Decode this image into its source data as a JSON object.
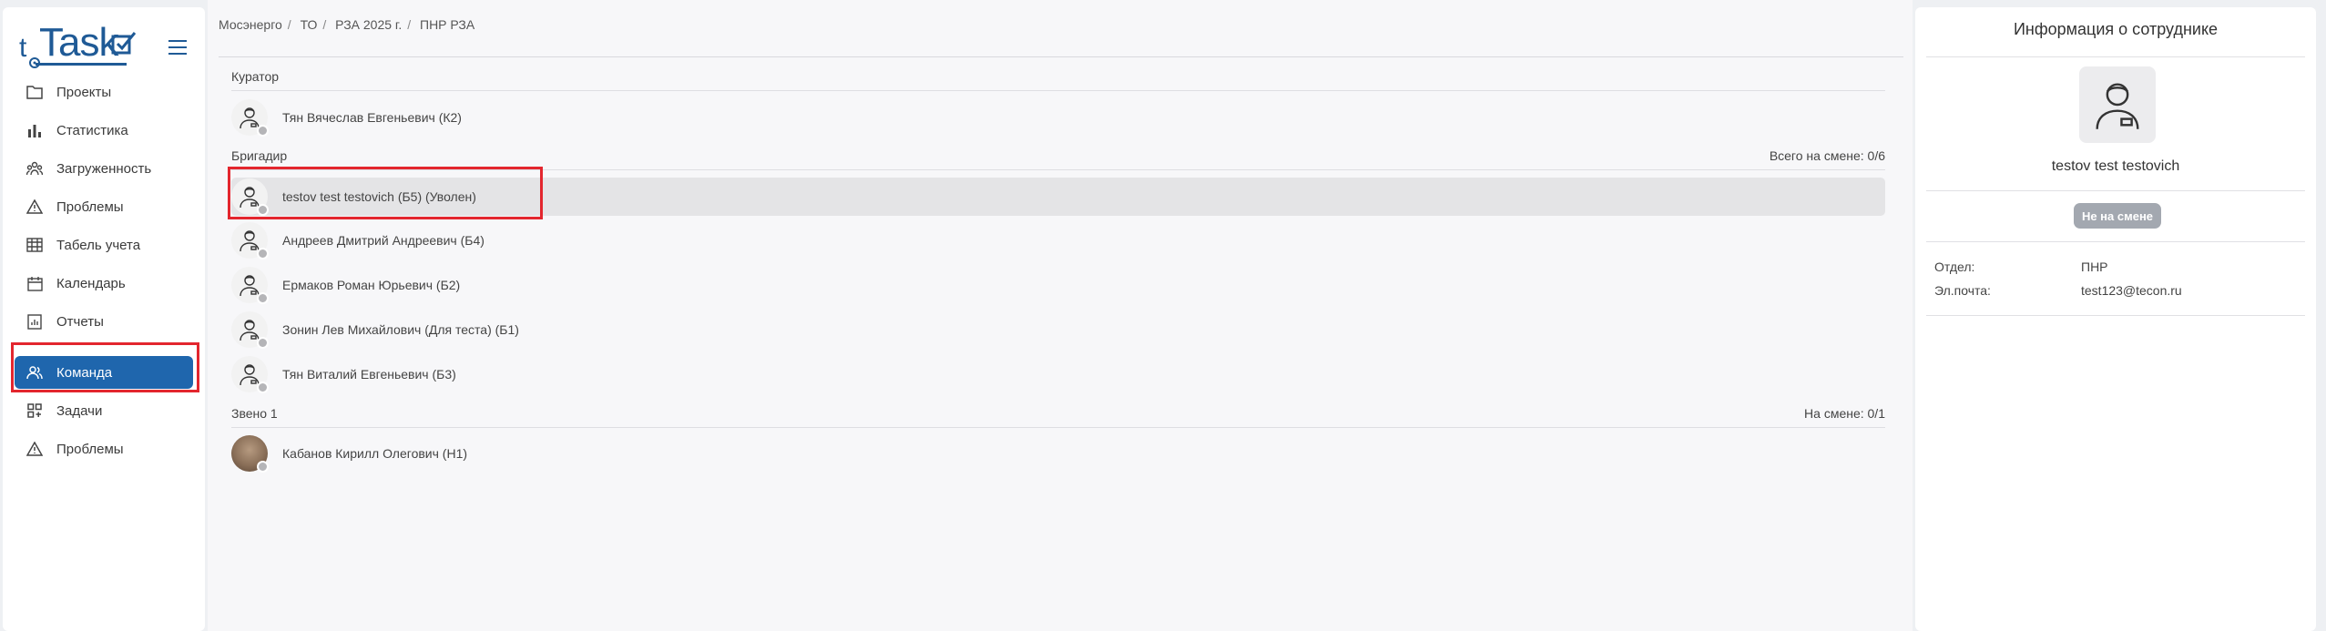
{
  "logo": {
    "small": "t",
    "text": "Task"
  },
  "sidebar": {
    "items": [
      {
        "label": "Проекты",
        "icon": "folder-icon"
      },
      {
        "label": "Статистика",
        "icon": "bar-chart-icon"
      },
      {
        "label": "Загруженность",
        "icon": "people-icon"
      },
      {
        "label": "Проблемы",
        "icon": "warning-icon"
      },
      {
        "label": "Табель учета",
        "icon": "table-icon"
      },
      {
        "label": "Календарь",
        "icon": "calendar-icon"
      },
      {
        "label": "Отчеты",
        "icon": "report-icon"
      }
    ],
    "items2": [
      {
        "label": "Команда",
        "icon": "team-icon"
      },
      {
        "label": "Задачи",
        "icon": "tasks-icon"
      },
      {
        "label": "Проблемы",
        "icon": "warning-icon"
      }
    ]
  },
  "breadcrumb": [
    "Мосэнерго",
    "ТО",
    "РЗА 2025 г.",
    "ПНР РЗА"
  ],
  "groups": {
    "curator": {
      "title": "Куратор",
      "members": [
        "Тян Вячеслав Евгеньевич (К2)"
      ]
    },
    "brigadier": {
      "title": "Бригадир",
      "shift": "Всего на смене: 0/6",
      "members": [
        "testov test testovich (Б5) (Уволен)",
        "Андреев Дмитрий Андреевич (Б4)",
        "Ермаков Роман Юрьевич (Б2)",
        "Зонин Лев Михайлович (Для теста) (Б1)",
        "Тян Виталий Евгеньевич (Б3)"
      ]
    },
    "link1": {
      "title": "Звено 1",
      "shift": "На смене: 0/1",
      "members": [
        "Кабанов Кирилл Олегович (Н1)"
      ]
    }
  },
  "employee": {
    "panel_title": "Информация о сотруднике",
    "name": "testov test testovich",
    "status": "Не на смене",
    "dept_label": "Отдел:",
    "dept_value": "ПНР",
    "email_label": "Эл.почта:",
    "email_value": "test123@tecon.ru"
  },
  "colors": {
    "brand": "#1f5a96",
    "active_nav": "#1f66ad",
    "highlight": "#e3262e",
    "status_badge": "#a3a8b0"
  }
}
